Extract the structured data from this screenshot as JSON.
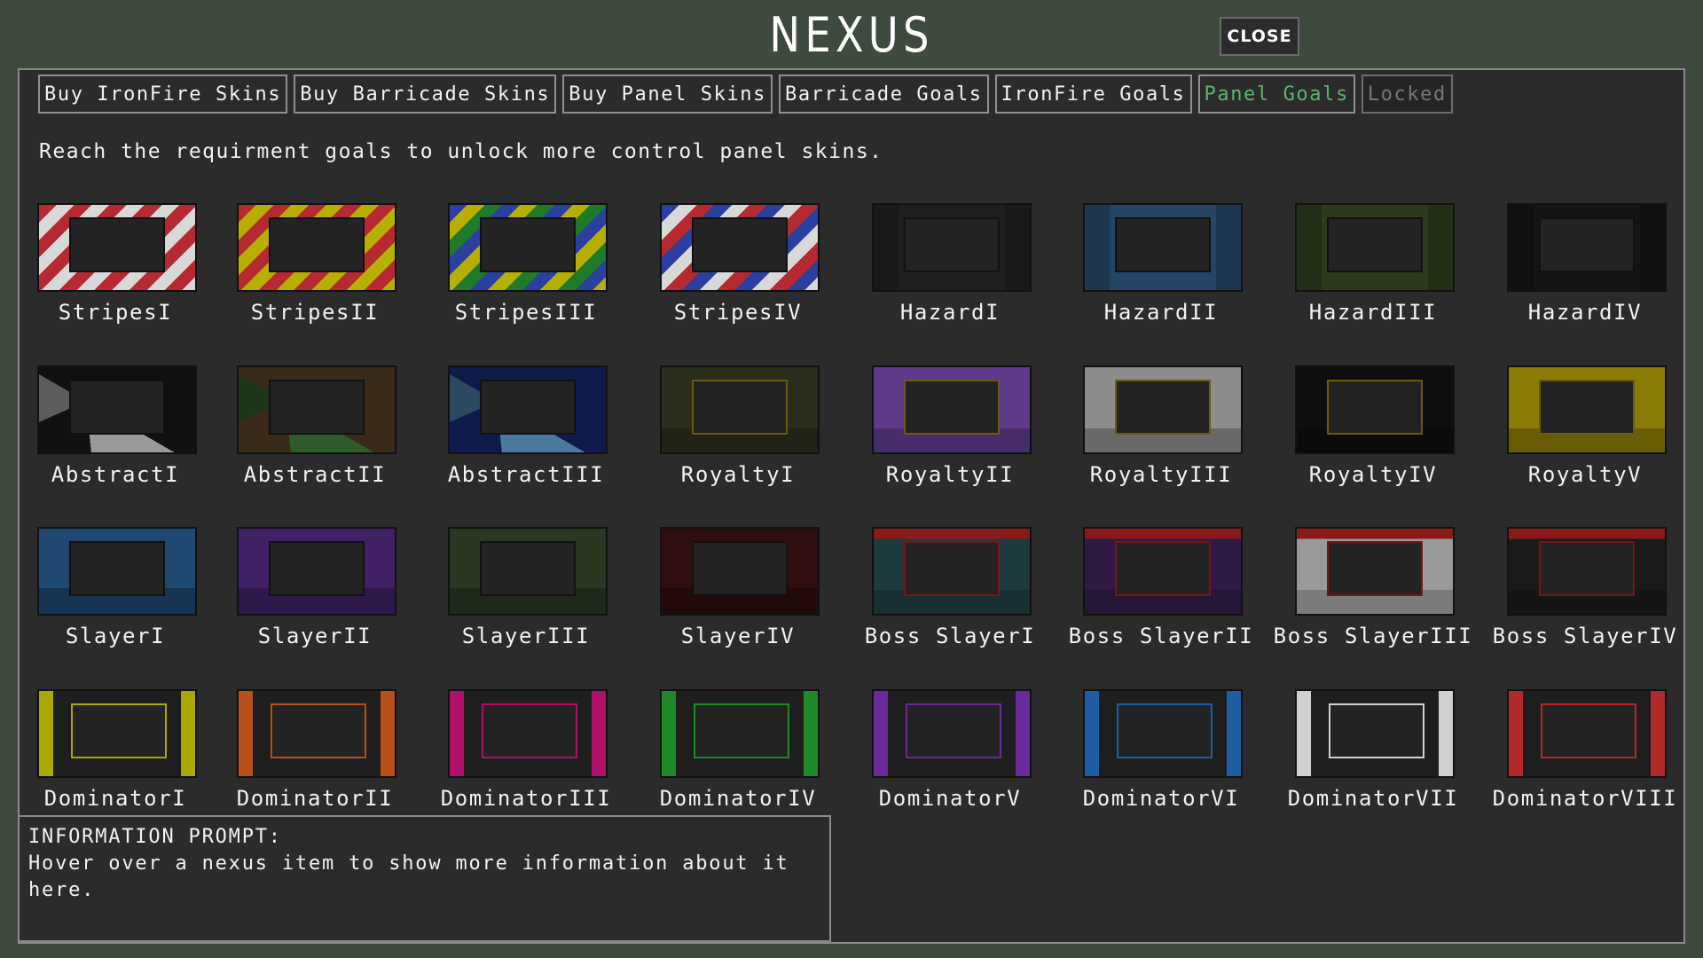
{
  "title": "NEXUS",
  "close_label": "CLOSE",
  "tabs": [
    {
      "label": "Buy IronFire Skins",
      "state": "normal"
    },
    {
      "label": "Buy Barricade Skins",
      "state": "normal"
    },
    {
      "label": "Buy Panel Skins",
      "state": "normal"
    },
    {
      "label": "Barricade Goals",
      "state": "normal"
    },
    {
      "label": "IronFire Goals",
      "state": "normal"
    },
    {
      "label": "Panel Goals",
      "state": "active"
    },
    {
      "label": "Locked",
      "state": "locked"
    }
  ],
  "description": "Reach the requirment goals to unlock more control panel skins.",
  "skins": [
    {
      "name": "StripesI",
      "style": "stripes",
      "colors": [
        "#b52a30",
        "#d8d8d8"
      ]
    },
    {
      "name": "StripesII",
      "style": "stripes",
      "colors": [
        "#b52a30",
        "#b8b000"
      ]
    },
    {
      "name": "StripesIII",
      "style": "stripes",
      "colors": [
        "#2a3fa0",
        "#b8b000",
        "#1f7a2a"
      ]
    },
    {
      "name": "StripesIV",
      "style": "stripes",
      "colors": [
        "#2a3fa0",
        "#d8d8d8",
        "#b52a30"
      ]
    },
    {
      "name": "HazardI",
      "style": "hazard",
      "colors": [
        "#1e1e1e"
      ]
    },
    {
      "name": "HazardII",
      "style": "hazard",
      "colors": [
        "#264463"
      ]
    },
    {
      "name": "HazardIII",
      "style": "hazard",
      "colors": [
        "#2c3a1e"
      ]
    },
    {
      "name": "HazardIV",
      "style": "hazard",
      "colors": [
        "#141414"
      ]
    },
    {
      "name": "AbstractI",
      "style": "abstract",
      "colors": [
        "#111111",
        "#9a9a9a"
      ]
    },
    {
      "name": "AbstractII",
      "style": "abstract",
      "colors": [
        "#3a2a1a",
        "#2f5a2a"
      ]
    },
    {
      "name": "AbstractIII",
      "style": "abstract",
      "colors": [
        "#0d1a4a",
        "#4a7aa0"
      ]
    },
    {
      "name": "RoyaltyI",
      "style": "royalty",
      "colors": [
        "#2a2e1c"
      ]
    },
    {
      "name": "RoyaltyII",
      "style": "royalty",
      "colors": [
        "#5d3a8a"
      ]
    },
    {
      "name": "RoyaltyIII",
      "style": "royalty",
      "colors": [
        "#8c8c8c"
      ]
    },
    {
      "name": "RoyaltyIV",
      "style": "royalty",
      "colors": [
        "#0e0e0e"
      ]
    },
    {
      "name": "RoyaltyV",
      "style": "royalty",
      "colors": [
        "#8a7c06"
      ]
    },
    {
      "name": "SlayerI",
      "style": "slayer",
      "colors": [
        "#1d4268"
      ]
    },
    {
      "name": "SlayerII",
      "style": "slayer",
      "colors": [
        "#3a1e5c"
      ]
    },
    {
      "name": "SlayerIII",
      "style": "slayer",
      "colors": [
        "#26331f"
      ]
    },
    {
      "name": "SlayerIV",
      "style": "slayer",
      "colors": [
        "#2c0c0e"
      ]
    },
    {
      "name": "Boss SlayerI",
      "style": "boss",
      "colors": [
        "#1f3a3f"
      ]
    },
    {
      "name": "Boss SlayerII",
      "style": "boss",
      "colors": [
        "#2e1a44"
      ]
    },
    {
      "name": "Boss SlayerIII",
      "style": "boss",
      "colors": [
        "#9a9a9a"
      ]
    },
    {
      "name": "Boss SlayerIV",
      "style": "boss",
      "colors": [
        "#1a1a1a"
      ]
    },
    {
      "name": "DominatorI",
      "style": "dominator",
      "colors": [
        "#a9a800"
      ]
    },
    {
      "name": "DominatorII",
      "style": "dominator",
      "colors": [
        "#b8501a"
      ]
    },
    {
      "name": "DominatorIII",
      "style": "dominator",
      "colors": [
        "#b0106a"
      ]
    },
    {
      "name": "DominatorIV",
      "style": "dominator",
      "colors": [
        "#1f8a2a"
      ]
    },
    {
      "name": "DominatorV",
      "style": "dominator",
      "colors": [
        "#6a2a9a"
      ]
    },
    {
      "name": "DominatorVI",
      "style": "dominator",
      "colors": [
        "#1f5ea0"
      ]
    },
    {
      "name": "DominatorVII",
      "style": "dominator",
      "colors": [
        "#d0d0d0"
      ]
    },
    {
      "name": "DominatorVIII",
      "style": "dominator",
      "colors": [
        "#b02a2a"
      ]
    }
  ],
  "info": {
    "heading": "INFORMATION PROMPT:",
    "text": "Hover over a nexus item to show more information about it here."
  }
}
